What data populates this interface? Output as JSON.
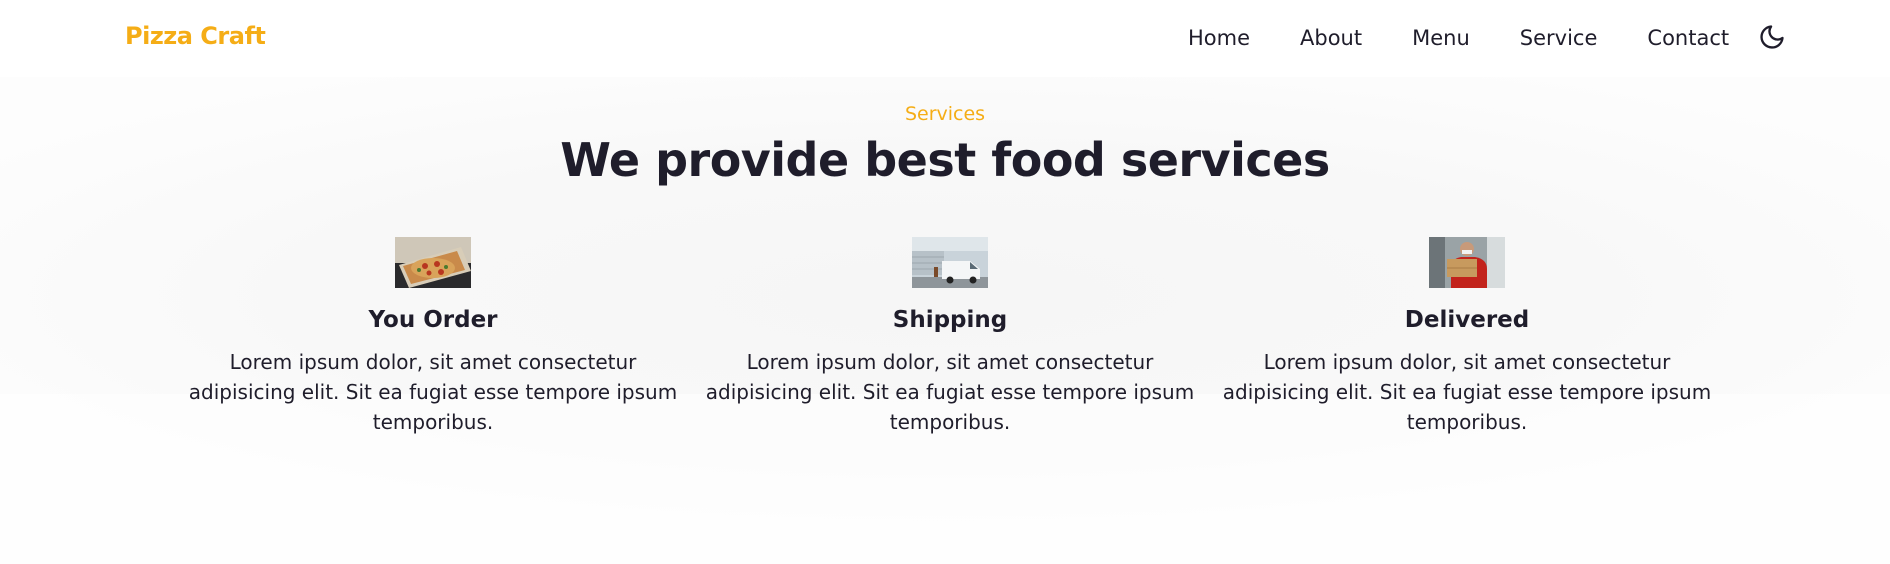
{
  "header": {
    "logo": "Pizza Craft",
    "nav": [
      "Home",
      "About",
      "Menu",
      "Service",
      "Contact"
    ],
    "theme_toggle_icon": "moon-icon"
  },
  "services": {
    "eyebrow": "Services",
    "title": "We provide best food services",
    "cards": [
      {
        "title": "You Order",
        "image": "pizza-box-photo",
        "text": "Lorem ipsum dolor, sit amet consectetur adipisicing elit. Sit ea fugiat esse tempore ipsum temporibus."
      },
      {
        "title": "Shipping",
        "image": "delivery-van-photo",
        "text": "Lorem ipsum dolor, sit amet consectetur adipisicing elit. Sit ea fugiat esse tempore ipsum temporibus."
      },
      {
        "title": "Delivered",
        "image": "courier-handing-box-photo",
        "text": "Lorem ipsum dolor, sit amet consectetur adipisicing elit. Sit ea fugiat esse tempore ipsum temporibus."
      }
    ]
  },
  "colors": {
    "accent": "#f5ad16",
    "text": "#1f1d2b"
  }
}
